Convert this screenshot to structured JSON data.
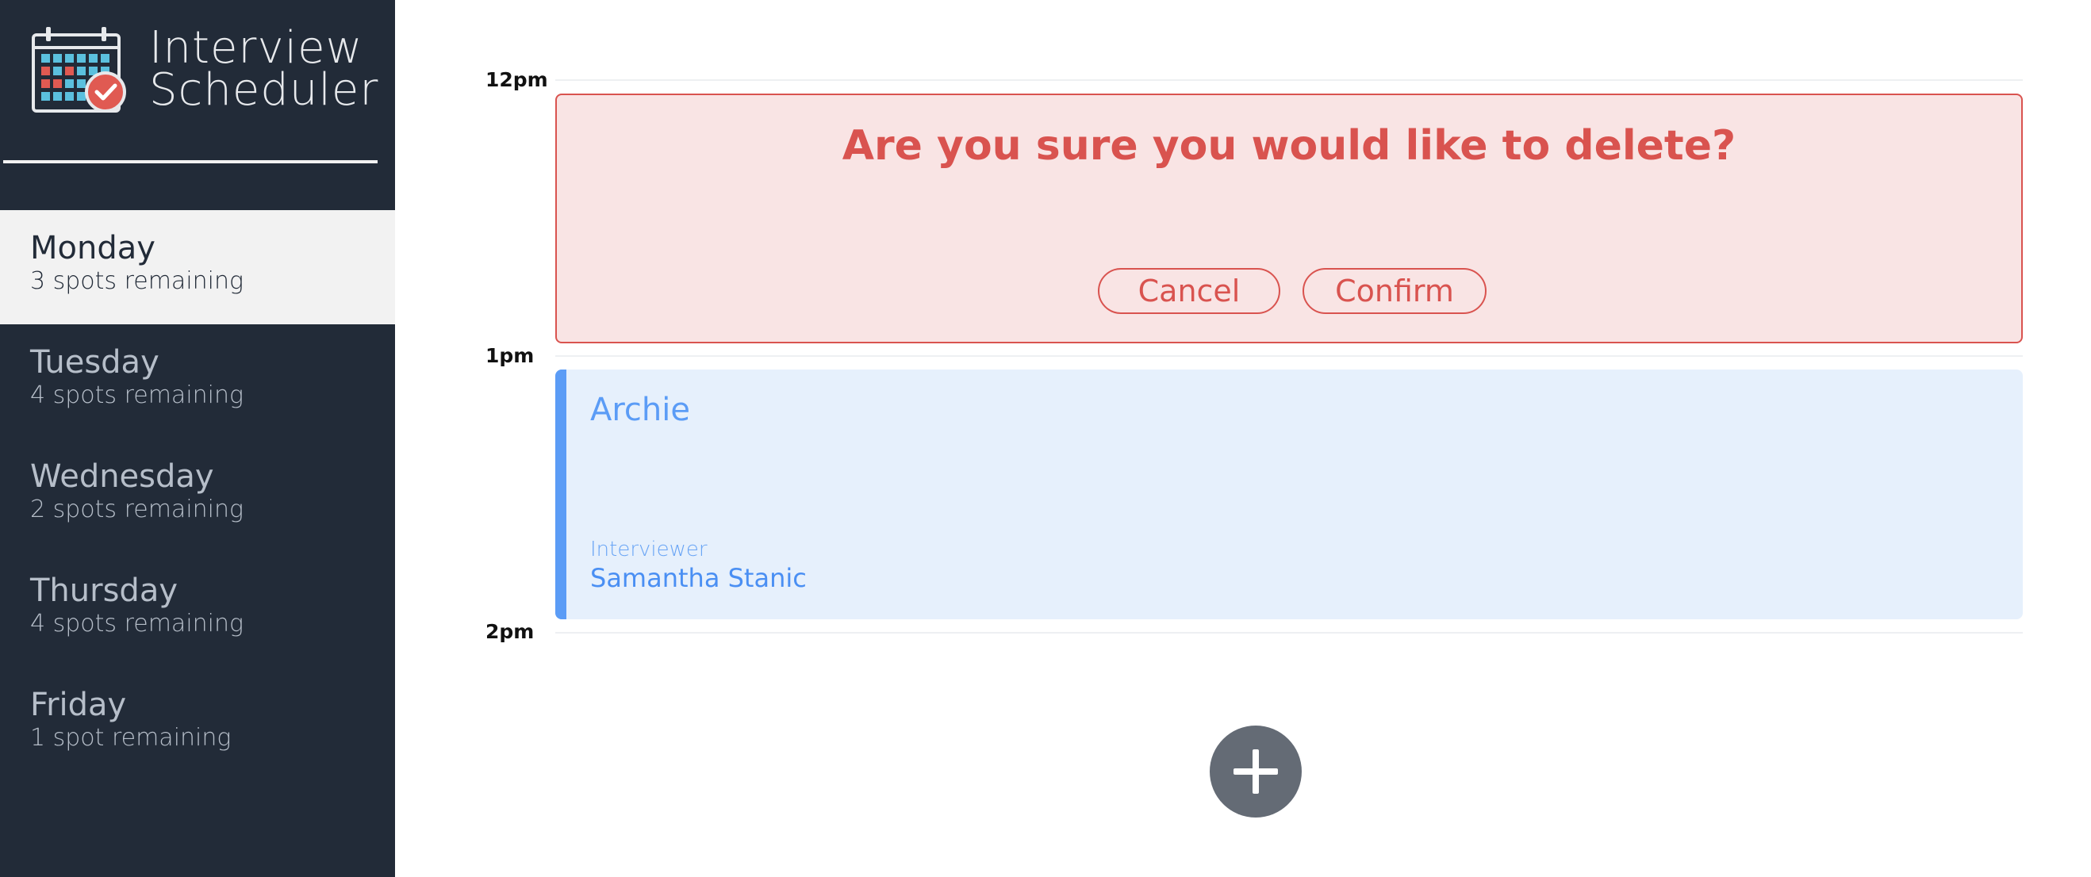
{
  "brand": {
    "title_line1": "Interview",
    "title_line2": "Scheduler",
    "logo_icon": "calendar-check-icon"
  },
  "sidebar": {
    "days": [
      {
        "name": "Monday",
        "spots": "3 spots remaining",
        "selected": true
      },
      {
        "name": "Tuesday",
        "spots": "4 spots remaining",
        "selected": false
      },
      {
        "name": "Wednesday",
        "spots": "2 spots remaining",
        "selected": false
      },
      {
        "name": "Thursday",
        "spots": "4 spots remaining",
        "selected": false
      },
      {
        "name": "Friday",
        "spots": "1 spot remaining",
        "selected": false
      }
    ]
  },
  "schedule": {
    "hours": [
      "12pm",
      "1pm",
      "2pm"
    ],
    "confirm": {
      "message": "Are you sure you would like to delete?",
      "cancel_label": "Cancel",
      "confirm_label": "Confirm"
    },
    "appointment": {
      "student": "Archie",
      "interviewer_label": "Interviewer",
      "interviewer_name": "Samantha Stanic"
    },
    "add_button_icon": "plus-icon"
  },
  "colors": {
    "sidebar_bg": "#222b38",
    "selected_day_bg": "#f2f2f2",
    "danger": "#d9534f",
    "danger_bg": "#f9e4e4",
    "appointment_accent": "#5b9cf6",
    "appointment_bg": "#e6f0fc",
    "add_button": "#646b75"
  }
}
